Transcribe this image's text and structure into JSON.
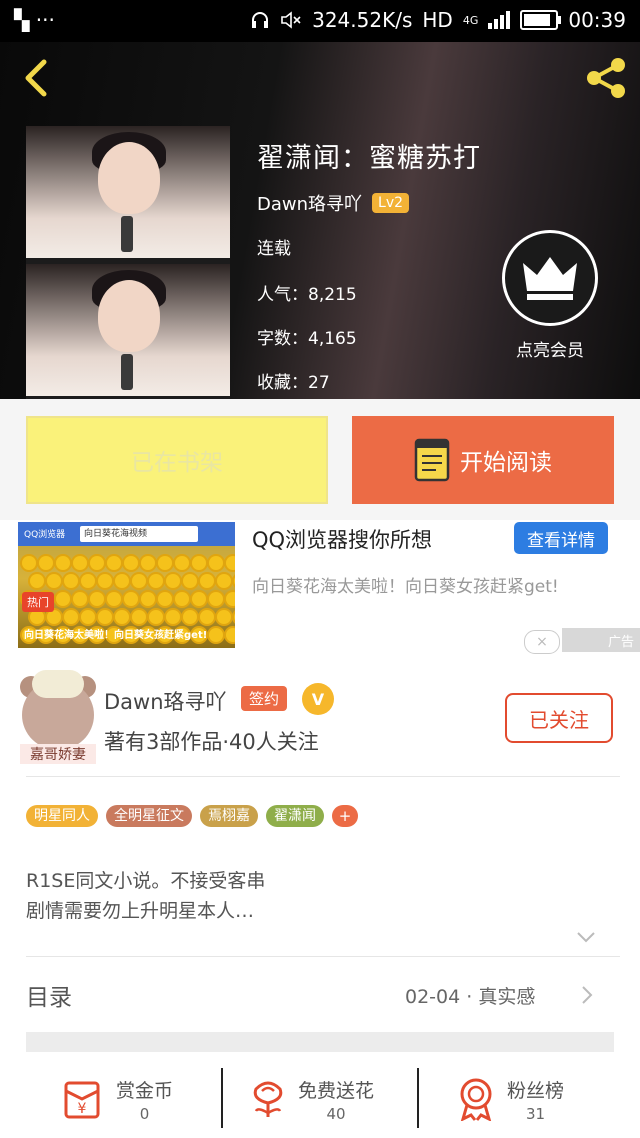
{
  "status_bar": {
    "network_speed": "324.52K/s",
    "network_type": "HD",
    "signal_gen": "4G",
    "time": "00:39",
    "battery_level": 0.85
  },
  "book": {
    "title": "翟潇闻：蜜糖苏打",
    "author": "Dawn珞寻吖",
    "level": "Lv2",
    "status": "连载",
    "popularity": "人气：8,215",
    "word_count": "字数：4,165",
    "favorites": "收藏：27",
    "vip_label": "点亮会员"
  },
  "actions": {
    "shelf_label": "已在书架",
    "read_label": "开始阅读"
  },
  "ad": {
    "title": "QQ浏览器搜你所想",
    "detail_button": "查看详情",
    "description": "向日葵花海太美啦！向日葵女孩赶紧get!",
    "tag": "广告",
    "close": "×",
    "image_brand": "QQ浏览器",
    "image_search_text": "向日葵花海视频",
    "image_search_button": "搜索",
    "image_hot": "热门",
    "image_caption": "向日葵花海太美啦！向日葵女孩赶紧get!"
  },
  "author": {
    "avatar_nick": "嘉哥娇妻",
    "name": "Dawn珞寻吖",
    "signed": "签约",
    "verified": "V",
    "stats": "著有3部作品·40人关注",
    "follow_label": "已关注"
  },
  "tags": [
    {
      "label": "明星同人",
      "color": "#f2b236"
    },
    {
      "label": "全明星征文",
      "color": "#c97a5e"
    },
    {
      "label": "焉栩嘉",
      "color": "#c9a14a"
    },
    {
      "label": "翟潇闻",
      "color": "#8fae4a"
    }
  ],
  "tag_add": "+",
  "synopsis": {
    "line1": "R1SE同文小说。不接受客串",
    "line2": "剧情需要勿上升明星本人…"
  },
  "toc": {
    "label": "目录",
    "latest": "02-04 · 真实感"
  },
  "bottom_bar": {
    "reward": {
      "label": "赏金币",
      "value": "0"
    },
    "flowers": {
      "label": "免费送花",
      "value": "40"
    },
    "fans": {
      "label": "粉丝榜",
      "value": "31"
    }
  },
  "colors": {
    "accent": "#ec6b45",
    "shelf_button": "#faf27a",
    "ad_button": "#2d7de2",
    "icon_red": "#e24b2f"
  }
}
